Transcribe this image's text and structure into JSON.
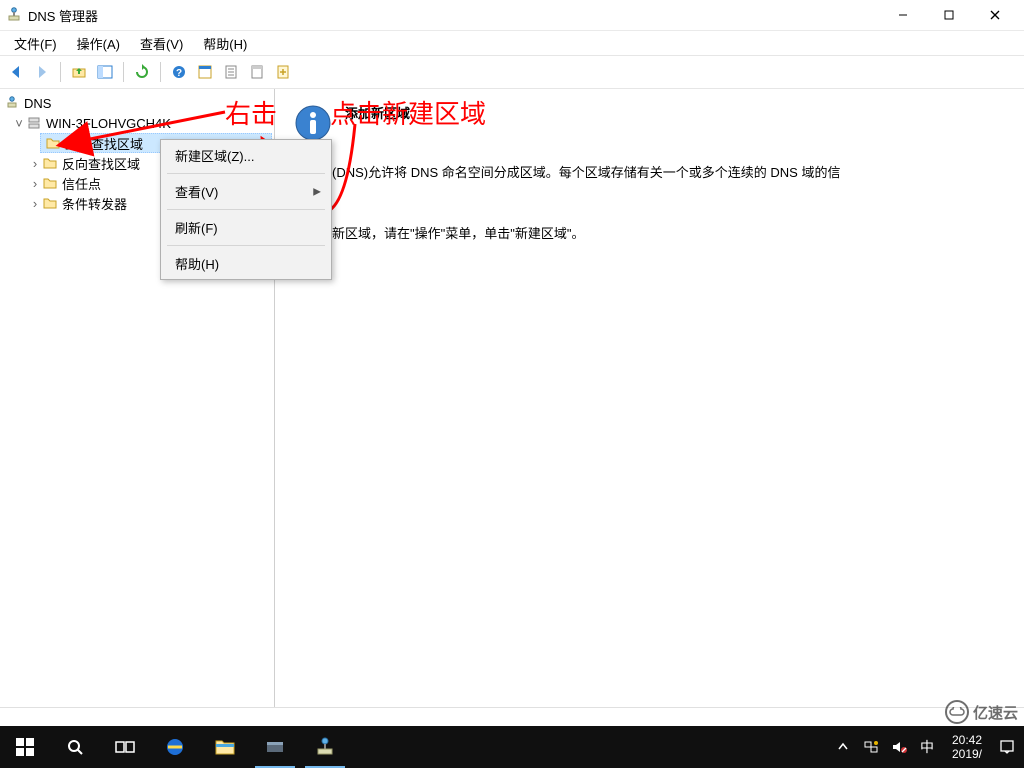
{
  "window": {
    "title": "DNS 管理器",
    "controls": {
      "min": "—",
      "max": "☐",
      "close": "✕"
    }
  },
  "menu": {
    "file": "文件(F)",
    "action": "操作(A)",
    "view": "查看(V)",
    "help": "帮助(H)"
  },
  "toolbarIcons": {
    "back": "nav-back-icon",
    "forward": "nav-forward-icon",
    "up": "folder-up-icon",
    "showhide": "showhide-pane-icon",
    "refresh": "refresh-icon",
    "help": "help-icon",
    "props": "properties-icon",
    "item8": "list-icon",
    "item9": "details-icon",
    "item10": "add-record-icon"
  },
  "tree": {
    "root": "DNS",
    "server": "WIN-3FLOHVGCH4K",
    "nodes": {
      "forward": "正向查找区域",
      "reverse": "反向查找区域",
      "trust": "信任点",
      "cond": "条件转发器"
    }
  },
  "contextMenu": {
    "newZone": "新建区域(Z)...",
    "view": "查看(V)",
    "refresh": "刷新(F)",
    "help": "帮助(H)"
  },
  "annotation": {
    "line1_a": "右击",
    "line1_b": "点击新建区域"
  },
  "content": {
    "heading": "添加新区域",
    "para1": "称系统(DNS)允许将 DNS 命名空间分成区域。每个区域存储有关一个或多个连续的 DNS 域的信",
    "para2": "加一个新区域，请在\"操作\"菜单，单击\"新建区域\"。"
  },
  "taskbar": {
    "time": "20:42",
    "date": "2019/"
  },
  "watermark": {
    "text": "亿速云"
  }
}
